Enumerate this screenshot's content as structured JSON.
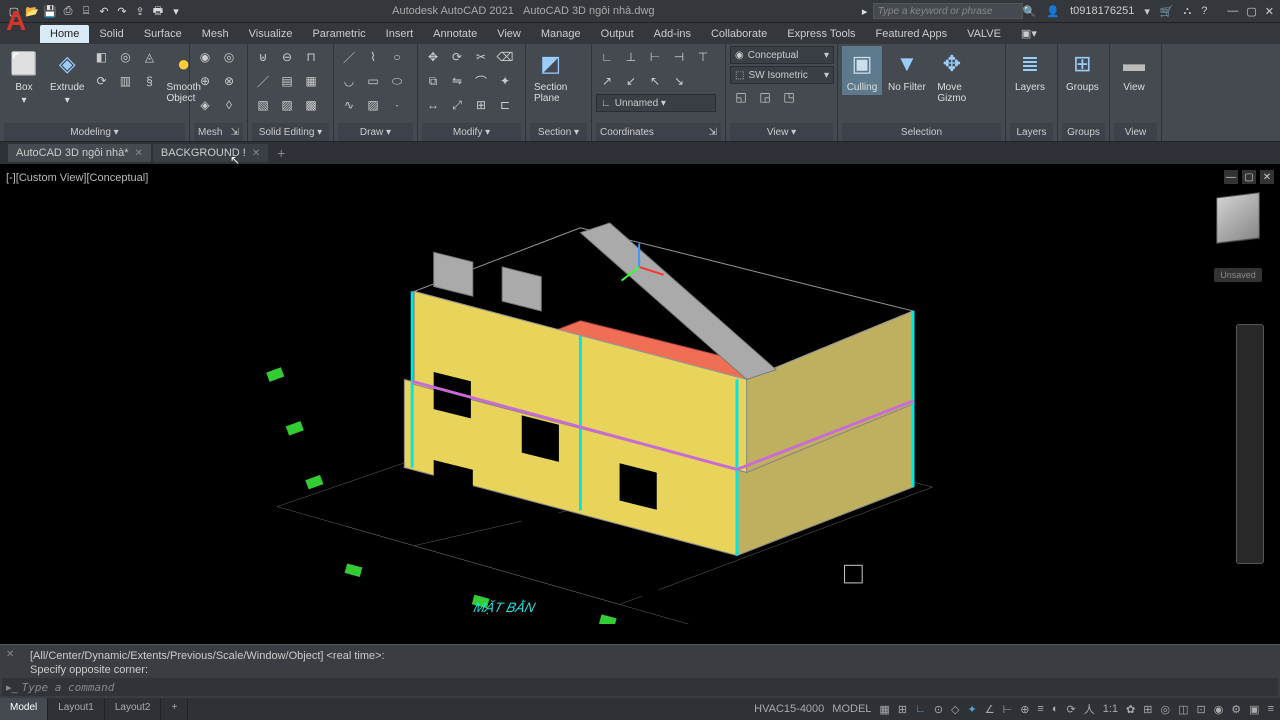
{
  "titlebar": {
    "app": "Autodesk AutoCAD 2021",
    "file": "AutoCAD 3D ngôi nhà.dwg",
    "search_placeholder": "Type a keyword or phrase",
    "user": "t0918176251",
    "qat_icons": [
      "new-icon",
      "open-icon",
      "save-icon",
      "saveas-icon",
      "plot-icon",
      "undo-icon",
      "redo-icon",
      "share-icon",
      "print-icon"
    ]
  },
  "ribbon": {
    "tabs": [
      "Home",
      "Solid",
      "Surface",
      "Mesh",
      "Visualize",
      "Parametric",
      "Insert",
      "Annotate",
      "View",
      "Manage",
      "Output",
      "Add-ins",
      "Collaborate",
      "Express Tools",
      "Featured Apps",
      "VALVE"
    ],
    "active_tab": "Home",
    "panels": {
      "modeling": {
        "label": "Modeling ▾",
        "box": "Box",
        "extrude": "Extrude",
        "smooth": "Smooth\nObject"
      },
      "mesh": {
        "label": "Mesh"
      },
      "solid_editing": {
        "label": "Solid Editing ▾"
      },
      "draw": {
        "label": "Draw ▾"
      },
      "modify": {
        "label": "Modify ▾"
      },
      "section": {
        "label": "Section ▾",
        "btn": "Section\nPlane"
      },
      "coordinates": {
        "label": "Coordinates",
        "unnamed": "Unnamed ▾"
      },
      "view": {
        "label": "View ▾",
        "style": "Conceptual",
        "iso": "SW Isometric"
      },
      "selection": {
        "label": "Selection",
        "culling": "Culling",
        "filter": "No Filter",
        "gizmo": "Move\nGizmo"
      },
      "layers": {
        "label": "Layers"
      },
      "groups": {
        "label": "Groups"
      },
      "view2": {
        "label": "View"
      }
    }
  },
  "file_tabs": [
    {
      "name": "AutoCAD 3D ngôi nhà*",
      "active": true
    },
    {
      "name": "BACKGROUND !",
      "active": false
    }
  ],
  "viewport": {
    "label": "[-][Custom View][Conceptual]",
    "cube_label": "Unsaved"
  },
  "command": {
    "line1": "[All/Center/Dynamic/Extents/Previous/Scale/Window/Object] <real time>:",
    "line2": "Specify opposite corner:",
    "placeholder": "Type a command",
    "prompt": "▸_"
  },
  "status": {
    "tabs": [
      "Model",
      "Layout1",
      "Layout2"
    ],
    "active_tab": "Model",
    "hvac": "HVAC15-4000",
    "model": "MODEL",
    "scale": "1:1"
  }
}
